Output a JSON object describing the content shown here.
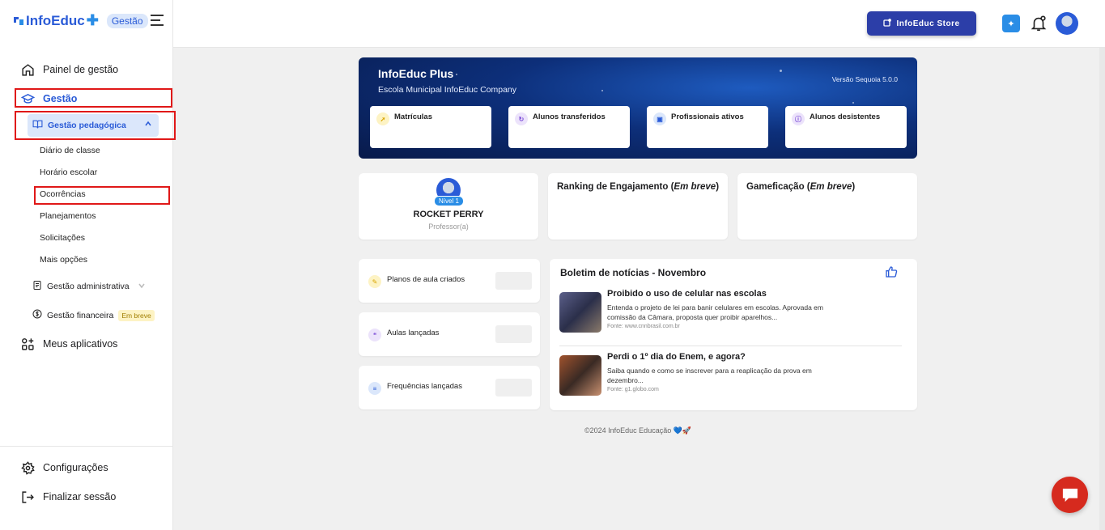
{
  "brand": {
    "name": "InfoEduc",
    "badge": "Gestão"
  },
  "sidebar": {
    "items": [
      {
        "label": "Painel de gestão",
        "icon": "home-icon"
      },
      {
        "label": "Gestão",
        "icon": "graduation-cap-icon"
      },
      {
        "label": "Gestão pedagógica",
        "icon": "book-icon"
      },
      {
        "label": "Gestão administrativa",
        "icon": "document-icon"
      },
      {
        "label": "Gestão financeira",
        "icon": "dollar-icon",
        "badge": "Em breve"
      },
      {
        "label": "Meus aplicativos",
        "icon": "apps-icon"
      },
      {
        "label": "Configurações",
        "icon": "gear-icon"
      },
      {
        "label": "Finalizar sessão",
        "icon": "logout-icon"
      }
    ],
    "pedagogica_subitems": [
      "Diário de classe",
      "Horário escolar",
      "Ocorrências",
      "Planejamentos",
      "Solicitações",
      "Mais opções"
    ]
  },
  "topbar": {
    "store_label": "InfoEduc Store"
  },
  "hero": {
    "title": "InfoEduc Plus",
    "subtitle": "Escola Municipal InfoEduc Company",
    "version": "Versão Sequoia 5.0.0",
    "stats": [
      "Matrículas",
      "Alunos transferidos",
      "Profissionais ativos",
      "Alunos desistentes"
    ]
  },
  "profile": {
    "level": "Nível 1",
    "name": "ROCKET PERRY",
    "role": "Professor(a)"
  },
  "ranking": {
    "title": "Ranking de Engajamento (",
    "soon": "Em breve",
    "close": ")"
  },
  "gamification": {
    "title": "Gameficação (",
    "soon": "Em breve",
    "close": ")"
  },
  "metrics": [
    "Planos de aula criados",
    "Aulas lançadas",
    "Frequências lançadas"
  ],
  "news": {
    "title": "Boletim de notícias - Novembro",
    "items": [
      {
        "headline": "Proibido o uso de celular nas escolas",
        "body": "Entenda o projeto de lei para banir celulares em escolas. Aprovada em comissão da Câmara, proposta quer proibir aparelhos...",
        "source": "Fonte: www.cnnbrasil.com.br"
      },
      {
        "headline": "Perdi o 1º dia do Enem, e agora?",
        "body": "Saiba quando e como se inscrever para a reaplicação da prova em dezembro...",
        "source": "Fonte: g1.globo.com"
      }
    ]
  },
  "footer": "©2024 InfoEduc Educação 💙🚀",
  "colors": {
    "primary": "#2a5bd7",
    "highlight": "#e01818",
    "chat": "#d62a1e"
  }
}
